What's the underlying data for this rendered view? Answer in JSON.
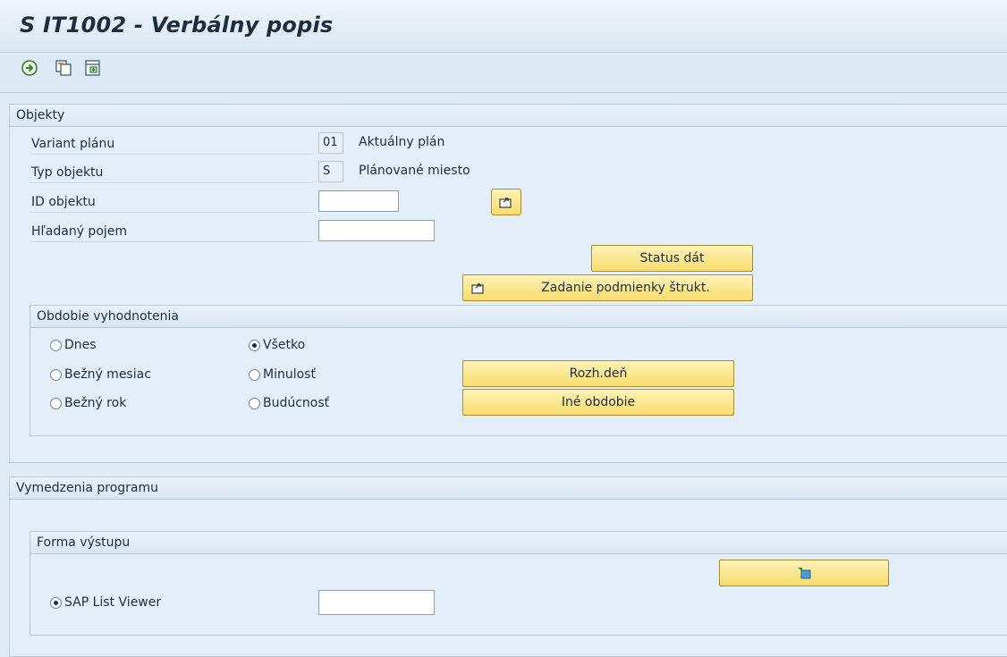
{
  "window": {
    "title": "S IT1002 - Verbálny popis"
  },
  "toolbar": {
    "icons": [
      "execute-icon",
      "copy-variant-icon",
      "selection-options-icon"
    ]
  },
  "objects": {
    "group_title": "Objekty",
    "plan_variant_label": "Variant plánu",
    "plan_variant_value": "01",
    "plan_variant_text": "Aktuálny plán",
    "object_type_label": "Typ objektu",
    "object_type_value": "S",
    "object_type_text": "Plánované miesto",
    "object_id_label": "ID objektu",
    "object_id_value": "",
    "search_term_label": "Hľadaný pojem",
    "search_term_value": "",
    "status_button": "Status dát",
    "structure_button": "Zadanie podmienky štrukt."
  },
  "evaluation_period": {
    "group_title": "Obdobie vyhodnotenia",
    "options": {
      "today": "Dnes",
      "current_month": "Bežný mesiac",
      "current_year": "Bežný rok",
      "all": "Všetko",
      "past": "Minulosť",
      "future": "Budúcnosť"
    },
    "selected": "all",
    "key_date_button": "Rozh.deň",
    "other_period_button": "Iné obdobie"
  },
  "program": {
    "group_title": "Vymedzenia programu",
    "output_group_title": "Forma výstupu",
    "alv_label": "SAP List Viewer",
    "alv_selected": true,
    "layout_value": ""
  },
  "colors": {
    "background": "#dfebf5",
    "button": "#f8dc6c",
    "text": "#1d2d3e"
  }
}
